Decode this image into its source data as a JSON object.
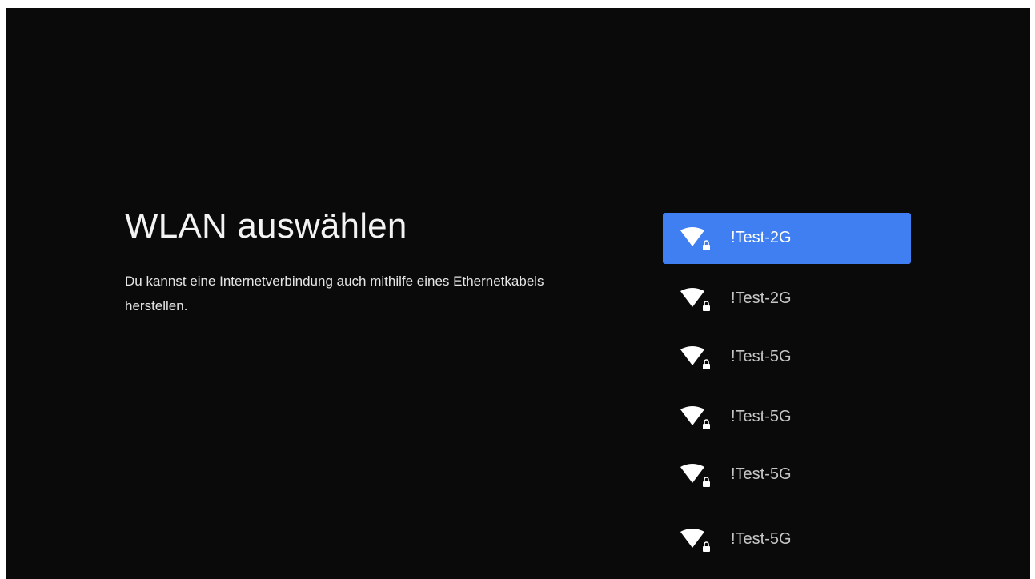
{
  "page": {
    "title": "WLAN auswählen",
    "description": "Du kannst eine Internetverbindung auch mithilfe eines Ethernetkabels herstellen."
  },
  "networks": [
    {
      "name": "!Test-2G",
      "icon": "wifi-lock-icon",
      "selected": true
    },
    {
      "name": "!Test-2G",
      "icon": "wifi-lock-icon",
      "selected": false
    },
    {
      "name": "!Test-5G",
      "icon": "wifi-lock-icon",
      "selected": false
    },
    {
      "name": "!Test-5G",
      "icon": "wifi-lock-icon",
      "selected": false
    },
    {
      "name": "!Test-5G",
      "icon": "wifi-lock-icon",
      "selected": false
    },
    {
      "name": "!Test-5G",
      "icon": "wifi-lock-icon",
      "selected": false
    }
  ],
  "colors": {
    "background": "#0a0a0a",
    "selected_item": "#3f7ff1",
    "title_text": "#f3f3f3",
    "item_text": "#c6c6c6"
  }
}
